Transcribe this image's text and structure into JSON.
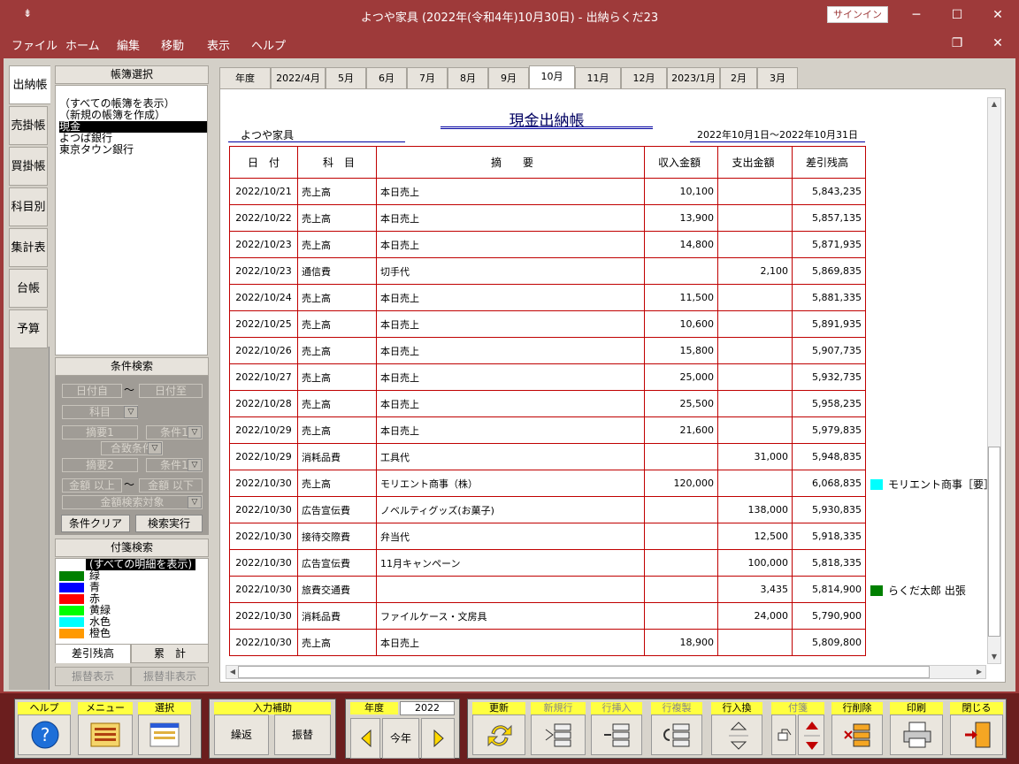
{
  "window": {
    "title": "よつや家具 (2022年(令和4年)10月30日)  -  出納らくだ23",
    "signin": "サインイン"
  },
  "menu": [
    "ファイル",
    "ホーム",
    "編集",
    "移動",
    "表示",
    "ヘルプ"
  ],
  "side_tabs": [
    "出納帳",
    "売掛帳",
    "買掛帳",
    "科目別",
    "集計表",
    "台帳",
    "予算"
  ],
  "book_select": {
    "header": "帳簿選択",
    "items": [
      "（すべての帳簿を表示）",
      "（新規の帳簿を作成）",
      "現金",
      "よつば銀行",
      "東京タウン銀行"
    ],
    "selected": "現金"
  },
  "cond_search": {
    "header": "条件検索",
    "date_from": "日付自",
    "tilde": "〜",
    "date_to": "日付至",
    "account": "科目",
    "memo1": "摘要1",
    "cond1": "条件1",
    "match": "合致条件",
    "memo2": "摘要2",
    "cond2": "条件1",
    "amount_min": "金額 以上",
    "amount_max": "金額 以下",
    "amount_target": "金額検索対象",
    "clear_btn": "条件クリア",
    "run_btn": "検索実行"
  },
  "tag_search": {
    "header": "付箋検索",
    "all": "(すべての明細を表示)",
    "tags": [
      {
        "name": "緑",
        "color": "#008000"
      },
      {
        "name": "青",
        "color": "#0000ff"
      },
      {
        "name": "赤",
        "color": "#ff0000"
      },
      {
        "name": "黄緑",
        "color": "#00ff00"
      },
      {
        "name": "水色",
        "color": "#00ffff"
      },
      {
        "name": "橙色",
        "color": "#ff9900"
      }
    ]
  },
  "bottom_tabs": {
    "balance": "差引残高",
    "cumulative": "累　計",
    "show_transfer": "振替表示",
    "hide_transfer": "振替非表示"
  },
  "month_tabs": [
    "年度",
    "2022/4月",
    "5月",
    "6月",
    "7月",
    "8月",
    "9月",
    "10月",
    "11月",
    "12月",
    "2023/1月",
    "2月",
    "3月"
  ],
  "active_month": "10月",
  "ledger": {
    "title": "現金出納帳",
    "company": "よつや家具",
    "period": "2022年10月1日〜2022年10月31日",
    "headers": [
      "日　付",
      "科　目",
      "摘　　要",
      "収入金額",
      "支出金額",
      "差引残高"
    ],
    "rows": [
      [
        "2022/10/21",
        "売上高",
        "本日売上",
        "10,100",
        "",
        "5,843,235"
      ],
      [
        "2022/10/22",
        "売上高",
        "本日売上",
        "13,900",
        "",
        "5,857,135"
      ],
      [
        "2022/10/23",
        "売上高",
        "本日売上",
        "14,800",
        "",
        "5,871,935"
      ],
      [
        "2022/10/23",
        "通信費",
        "切手代",
        "",
        "2,100",
        "5,869,835"
      ],
      [
        "2022/10/24",
        "売上高",
        "本日売上",
        "11,500",
        "",
        "5,881,335"
      ],
      [
        "2022/10/25",
        "売上高",
        "本日売上",
        "10,600",
        "",
        "5,891,935"
      ],
      [
        "2022/10/26",
        "売上高",
        "本日売上",
        "15,800",
        "",
        "5,907,735"
      ],
      [
        "2022/10/27",
        "売上高",
        "本日売上",
        "25,000",
        "",
        "5,932,735"
      ],
      [
        "2022/10/28",
        "売上高",
        "本日売上",
        "25,500",
        "",
        "5,958,235"
      ],
      [
        "2022/10/29",
        "売上高",
        "本日売上",
        "21,600",
        "",
        "5,979,835"
      ],
      [
        "2022/10/29",
        "消耗品費",
        "工具代",
        "",
        "31,000",
        "5,948,835"
      ],
      [
        "2022/10/30",
        "売上高",
        "モリエント商事（株）",
        "120,000",
        "",
        "6,068,835"
      ],
      [
        "2022/10/30",
        "広告宣伝費",
        "ノベルティグッズ(お菓子)",
        "",
        "138,000",
        "5,930,835"
      ],
      [
        "2022/10/30",
        "接待交際費",
        "弁当代",
        "",
        "12,500",
        "5,918,335"
      ],
      [
        "2022/10/30",
        "広告宣伝費",
        "11月キャンペーン",
        "",
        "100,000",
        "5,818,335"
      ],
      [
        "2022/10/30",
        "旅費交通費",
        "",
        "",
        "3,435",
        "5,814,900"
      ],
      [
        "2022/10/30",
        "消耗品費",
        "ファイルケース・文房具",
        "",
        "24,000",
        "5,790,900"
      ],
      [
        "2022/10/30",
        "売上高",
        "本日売上",
        "18,900",
        "",
        "5,809,800"
      ]
    ],
    "notes": [
      {
        "text": "モリエント商事［要］電",
        "color": "#00ffff"
      },
      {
        "text": "らくだ太郎  出張",
        "color": "#008000"
      }
    ]
  },
  "toolbar": {
    "help": "ヘルプ",
    "menu": "メニュー",
    "select": "選択",
    "input_assist": "入力補助",
    "repeat": "繰返",
    "transfer": "振替",
    "year_label": "年度",
    "year_value": "2022",
    "this_year": "今年",
    "update": "更新",
    "new_row": "新規行",
    "insert_row": "行挿入",
    "copy_row": "行複製",
    "swap_row": "行入換",
    "tag": "付箋",
    "delete_row": "行削除",
    "print": "印刷",
    "close": "閉じる"
  }
}
